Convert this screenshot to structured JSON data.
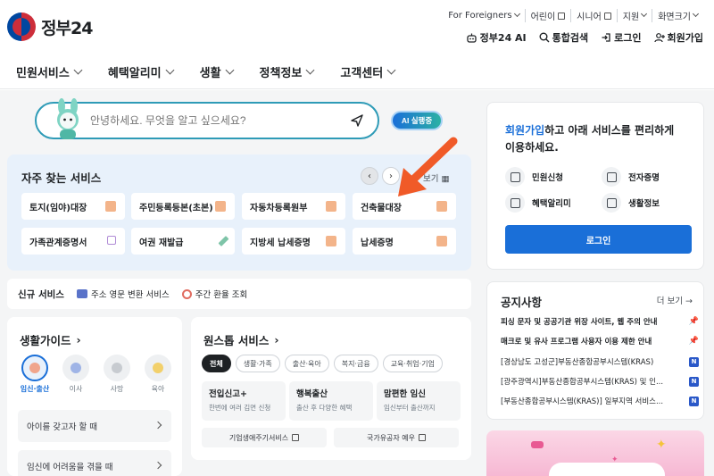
{
  "header": {
    "logo_text": "정부",
    "logo_num": "24",
    "utility": [
      "For Foreigners",
      "어린이",
      "시니어",
      "지원",
      "화면크기"
    ],
    "actions": [
      "정부24 AI",
      "통합검색",
      "로그인",
      "회원가입"
    ]
  },
  "nav": [
    "민원서비스",
    "혜택알리미",
    "생활",
    "정책정보",
    "고객센터"
  ],
  "search": {
    "placeholder": "안녕하세요. 무엇을 알고 싶으세요?",
    "ai_button": "AI 실행중"
  },
  "frequent": {
    "title": "자주 찾는 서비스",
    "more": "보기",
    "items": [
      "토지(임야)대장",
      "주민등록등본(초본)",
      "자동차등록원부",
      "건축물대장",
      "가족관계증명서",
      "여권 재발급",
      "지방세 납세증명",
      "납세증명"
    ]
  },
  "new_services": {
    "label": "신규 서비스",
    "items": [
      "주소 영문 변환 서비스",
      "주간 환율 조회"
    ]
  },
  "life_guide": {
    "title": "생활가이드",
    "categories": [
      "임신·출산",
      "이사",
      "사망",
      "육아"
    ],
    "items": [
      "아이를 갖고자 할 때",
      "임신에 어려움을 겪을 때"
    ]
  },
  "one_stop": {
    "title": "원스톱 서비스",
    "chips": [
      "전체",
      "생활·가족",
      "출산·육아",
      "복지·금융",
      "교육·취업·기업"
    ],
    "cards": [
      {
        "title": "전입신고+",
        "sub": "한번에 여러 김면 신청"
      },
      {
        "title": "행복출산",
        "sub": "출산 후 다양한 혜택"
      },
      {
        "title": "맘편한 임신",
        "sub": "임신부터 출산까지"
      }
    ],
    "links": [
      "기업생애주기서비스",
      "국가유공자 예우"
    ]
  },
  "login": {
    "msg_highlight": "회원가입",
    "msg_rest": "하고 아래 서비스를 편리하게 이용하세요.",
    "quick": [
      "민원신청",
      "전자증명",
      "혜택알리미",
      "생활정보"
    ],
    "button": "로그인"
  },
  "notice": {
    "title": "공지사항",
    "more": "더 보기 →",
    "rows": [
      {
        "text": "피싱 문자 및 공공기관 위장 사이트, 웹 주의 안내",
        "bold": true,
        "pin": true
      },
      {
        "text": "매크로 및 유사 프로그램 사용자 이용 제한 안내",
        "bold": true,
        "pin": true
      },
      {
        "text": "[경상남도 고성군]부동산종합공부시스템(KRAS)",
        "badge": "N"
      },
      {
        "text": "[광주광역시]부동산종합공부시스템(KRAS) 및 인...",
        "badge": "N"
      },
      {
        "text": "[부동산종합공부시스템(KRAS)] 일부지역 서비스...",
        "badge": "N"
      }
    ]
  },
  "colors": {
    "primary": "#1a6fd8",
    "teal": "#2e9bb7",
    "freq_bg": "#e8f1fb",
    "arrow": "#f05a28"
  }
}
